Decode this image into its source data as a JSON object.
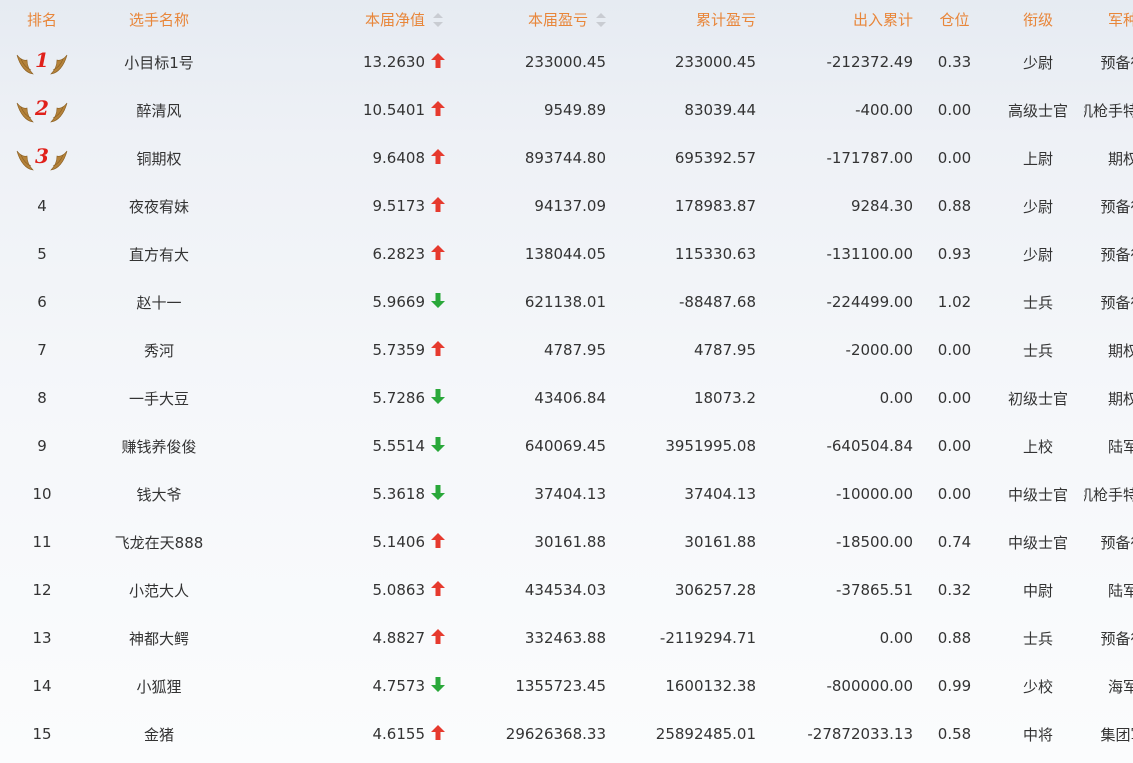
{
  "colors": {
    "header_text": "#e8863a",
    "rank_number": "#e0201a",
    "arrow_up": "#e63a2e",
    "arrow_down": "#2aa83a",
    "wing_gold": "#b4823a"
  },
  "headers": {
    "rank": "排名",
    "name": "选手名称",
    "net_value": "本届净值",
    "period_pnl": "本届盈亏",
    "total_pnl": "累计盈亏",
    "inout": "出入累计",
    "position": "仓位",
    "grade": "衔级",
    "branch": "军种"
  },
  "rows": [
    {
      "rank": "1",
      "medal": true,
      "name": "小目标1号",
      "nv": "13.2630",
      "trend": "up",
      "period_pnl": "233000.45",
      "total_pnl": "233000.45",
      "inout": "-212372.49",
      "position": "0.33",
      "grade": "少尉",
      "branch": "预备役"
    },
    {
      "rank": "2",
      "medal": true,
      "name": "醉清风",
      "nv": "10.5401",
      "trend": "up",
      "period_pnl": "9549.89",
      "total_pnl": "83039.44",
      "inout": "-400.00",
      "position": "0.00",
      "grade": "高级士官",
      "branch": "机枪手特战营"
    },
    {
      "rank": "3",
      "medal": true,
      "name": "铜期权",
      "nv": "9.6408",
      "trend": "up",
      "period_pnl": "893744.80",
      "total_pnl": "695392.57",
      "inout": "-171787.00",
      "position": "0.00",
      "grade": "上尉",
      "branch": "期权"
    },
    {
      "rank": "4",
      "medal": false,
      "name": "夜夜宥妹",
      "nv": "9.5173",
      "trend": "up",
      "period_pnl": "94137.09",
      "total_pnl": "178983.87",
      "inout": "9284.30",
      "position": "0.88",
      "grade": "少尉",
      "branch": "预备役"
    },
    {
      "rank": "5",
      "medal": false,
      "name": "直方有大",
      "nv": "6.2823",
      "trend": "up",
      "period_pnl": "138044.05",
      "total_pnl": "115330.63",
      "inout": "-131100.00",
      "position": "0.93",
      "grade": "少尉",
      "branch": "预备役"
    },
    {
      "rank": "6",
      "medal": false,
      "name": "赵十一",
      "nv": "5.9669",
      "trend": "down",
      "period_pnl": "621138.01",
      "total_pnl": "-88487.68",
      "inout": "-224499.00",
      "position": "1.02",
      "grade": "士兵",
      "branch": "预备役"
    },
    {
      "rank": "7",
      "medal": false,
      "name": "秀河",
      "nv": "5.7359",
      "trend": "up",
      "period_pnl": "4787.95",
      "total_pnl": "4787.95",
      "inout": "-2000.00",
      "position": "0.00",
      "grade": "士兵",
      "branch": "期权"
    },
    {
      "rank": "8",
      "medal": false,
      "name": "一手大豆",
      "nv": "5.7286",
      "trend": "down",
      "period_pnl": "43406.84",
      "total_pnl": "18073.2",
      "inout": "0.00",
      "position": "0.00",
      "grade": "初级士官",
      "branch": "期权"
    },
    {
      "rank": "9",
      "medal": false,
      "name": "赚钱养俊俊",
      "nv": "5.5514",
      "trend": "down",
      "period_pnl": "640069.45",
      "total_pnl": "3951995.08",
      "inout": "-640504.84",
      "position": "0.00",
      "grade": "上校",
      "branch": "陆军"
    },
    {
      "rank": "10",
      "medal": false,
      "name": "钱大爷",
      "nv": "5.3618",
      "trend": "down",
      "period_pnl": "37404.13",
      "total_pnl": "37404.13",
      "inout": "-10000.00",
      "position": "0.00",
      "grade": "中级士官",
      "branch": "机枪手特战营"
    },
    {
      "rank": "11",
      "medal": false,
      "name": "飞龙在天888",
      "nv": "5.1406",
      "trend": "up",
      "period_pnl": "30161.88",
      "total_pnl": "30161.88",
      "inout": "-18500.00",
      "position": "0.74",
      "grade": "中级士官",
      "branch": "预备役"
    },
    {
      "rank": "12",
      "medal": false,
      "name": "小范大人",
      "nv": "5.0863",
      "trend": "up",
      "period_pnl": "434534.03",
      "total_pnl": "306257.28",
      "inout": "-37865.51",
      "position": "0.32",
      "grade": "中尉",
      "branch": "陆军"
    },
    {
      "rank": "13",
      "medal": false,
      "name": "神都大鳄",
      "nv": "4.8827",
      "trend": "up",
      "period_pnl": "332463.88",
      "total_pnl": "-2119294.71",
      "inout": "0.00",
      "position": "0.88",
      "grade": "士兵",
      "branch": "预备役"
    },
    {
      "rank": "14",
      "medal": false,
      "name": "小狐狸",
      "nv": "4.7573",
      "trend": "down",
      "period_pnl": "1355723.45",
      "total_pnl": "1600132.38",
      "inout": "-800000.00",
      "position": "0.99",
      "grade": "少校",
      "branch": "海军"
    },
    {
      "rank": "15",
      "medal": false,
      "name": "金猪",
      "nv": "4.6155",
      "trend": "up",
      "period_pnl": "29626368.33",
      "total_pnl": "25892485.01",
      "inout": "-27872033.13",
      "position": "0.58",
      "grade": "中将",
      "branch": "集团军"
    }
  ]
}
